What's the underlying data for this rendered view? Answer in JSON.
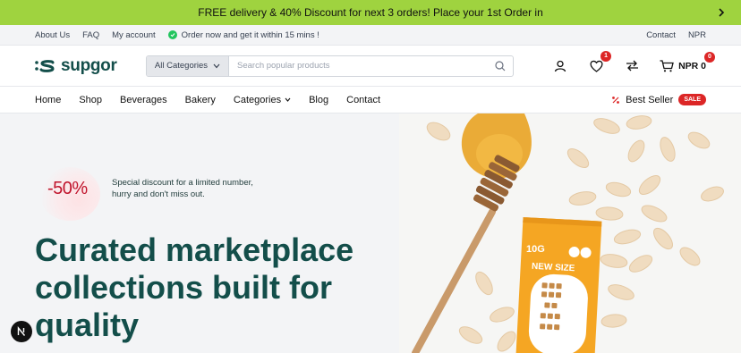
{
  "promo": {
    "text": "FREE delivery & 40% Discount for next 3 orders! Place your 1st Order in"
  },
  "utility": {
    "links": [
      "About Us",
      "FAQ",
      "My account"
    ],
    "notice": "Order now and get it within 15 mins !",
    "right_links": [
      "Contact",
      "NPR"
    ]
  },
  "header": {
    "logo_text": "supgor",
    "category_select": "All Categories",
    "search_placeholder": "Search popular products",
    "wishlist_count": "1",
    "cart_total": "NPR 0",
    "cart_count": "0"
  },
  "nav": {
    "items": [
      "Home",
      "Shop",
      "Beverages",
      "Bakery",
      "Categories",
      "Blog",
      "Contact"
    ],
    "best_seller": "Best Seller",
    "sale_badge": "SALE"
  },
  "hero": {
    "discount": "-50%",
    "discount_text": "Special discount for a limited number, hurry and don't miss out.",
    "title": "Curated marketplace collections built for quality",
    "package_top": "10G",
    "package_label": "NEW SIZE"
  },
  "colors": {
    "promo_bg": "#9fd33f",
    "brand": "#134e4a",
    "sale_red": "#dc2626",
    "discount_red": "#c0142c",
    "package_orange": "#f5a623"
  },
  "icons": [
    "chevron-right-icon",
    "check-circle-icon",
    "chevron-down-icon",
    "search-icon",
    "user-icon",
    "heart-icon",
    "compare-arrows-icon",
    "cart-icon",
    "percent-icon",
    "next-logo-icon"
  ]
}
